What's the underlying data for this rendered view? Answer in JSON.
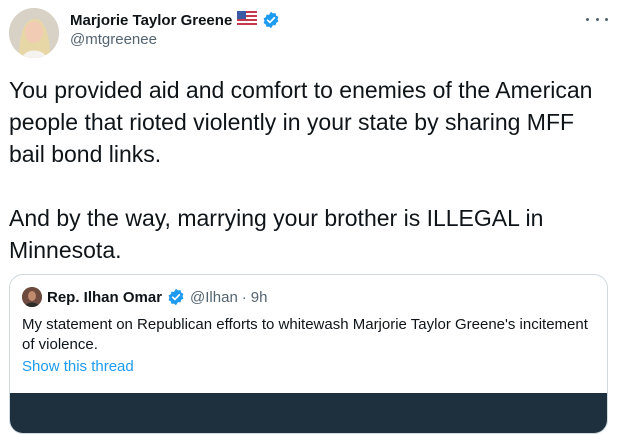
{
  "tweet": {
    "author": {
      "name": "Marjorie Taylor Greene",
      "flag_icon": "us-flag-icon",
      "verified_icon": "verified-badge-icon",
      "handle": "@mtgreenee"
    },
    "more_icon": "more-options-icon",
    "text": "You provided aid and comfort to enemies of the American people that rioted violently in your state by sharing MFF bail bond links.\n\nAnd by the way, marrying your brother is ILLEGAL in Minnesota."
  },
  "quoted": {
    "author": {
      "name": "Rep. Ilhan Omar",
      "verified_icon": "verified-badge-icon",
      "handle": "@Ilhan",
      "separator": "·",
      "time": "9h"
    },
    "text": "My statement on Republican efforts to whitewash Marjorie Taylor Greene's incitement of violence.",
    "show_thread": "Show this thread"
  },
  "colors": {
    "link_blue": "#1d9bf0",
    "secondary_text": "#536471",
    "verified_blue": "#1d9bf0",
    "border": "#cfd9de",
    "media_dark": "#1e2f3e"
  }
}
